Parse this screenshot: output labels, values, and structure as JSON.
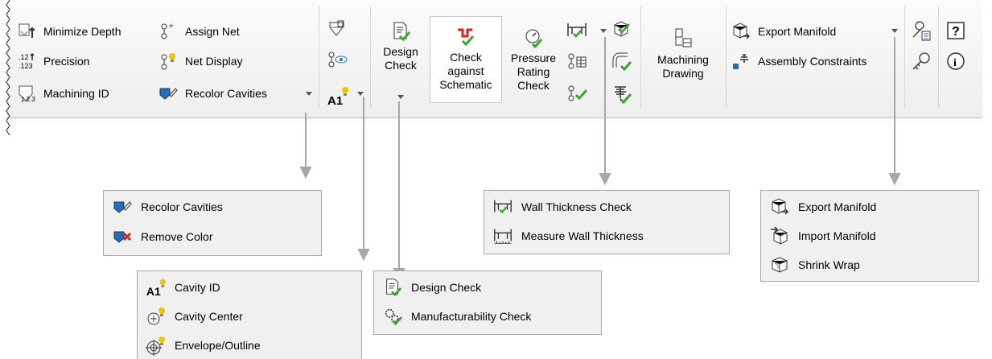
{
  "colors": {
    "check_green": "#3aa42f",
    "bulb_yellow": "#f2c400",
    "red_x": "#d9251c",
    "blue": "#1f6fc0",
    "arrow_gray": "#a7a7a7"
  },
  "ribbon": {
    "left_col1": [
      "Minimize Depth",
      "Precision",
      "Machining ID"
    ],
    "left_col2": [
      "Assign Net",
      "Net Display",
      "Recolor Cavities"
    ],
    "small_icons_group": [
      "cut-view-icon",
      "eye-view-icon",
      "cavity-id-icon"
    ],
    "design_check": {
      "line1": "Design",
      "line2": "Check"
    },
    "check_schematic": {
      "line1": "Check",
      "line2": "against",
      "line3": "Schematic"
    },
    "pressure_rating": {
      "line1": "Pressure",
      "line2": "Rating",
      "line3": "Check"
    },
    "machining_drawing": {
      "line1": "Machining",
      "line2": "Drawing"
    },
    "export_manifold": "Export Manifold",
    "assembly_constraints": "Assembly Constraints"
  },
  "panels": {
    "recolor": [
      "Recolor Cavities",
      "Remove Color"
    ],
    "cavity": [
      "Cavity ID",
      "Cavity Center",
      "Envelope/Outline"
    ],
    "design": [
      "Design Check",
      "Manufacturability Check"
    ],
    "wall": [
      "Wall Thickness Check",
      "Measure Wall Thickness"
    ],
    "manifold": [
      "Export Manifold",
      "Import Manifold",
      "Shrink Wrap"
    ]
  }
}
